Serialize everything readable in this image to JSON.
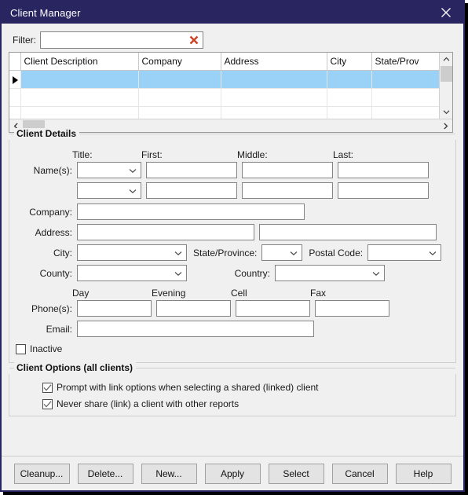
{
  "window": {
    "title": "Client Manager",
    "close_icon": "close-icon",
    "accent_color": "#282560",
    "selection_color": "#99d1f7",
    "clear_icon_color": "#cc4125"
  },
  "filter": {
    "label": "Filter:",
    "value": "",
    "placeholder": "",
    "clear_icon": "clear-x-icon"
  },
  "grid": {
    "columns": [
      "Client Description",
      "Company",
      "Address",
      "City",
      "State/Prov"
    ],
    "rows": [
      {
        "selected": true,
        "cells": [
          "",
          "",
          "",
          "",
          ""
        ]
      },
      {
        "selected": false,
        "cells": [
          "",
          "",
          "",
          "",
          ""
        ]
      },
      {
        "selected": false,
        "cells": [
          "",
          "",
          "",
          "",
          ""
        ]
      },
      {
        "selected": false,
        "cells": [
          "",
          "",
          "",
          "",
          ""
        ]
      }
    ],
    "scroll_up_icon": "chevron-up-icon",
    "scroll_down_icon": "chevron-down-icon",
    "scroll_left_icon": "chevron-left-icon",
    "scroll_right_icon": "chevron-right-icon"
  },
  "client_details": {
    "title": "Client Details",
    "name_headers": {
      "title": "Title:",
      "first": "First:",
      "middle": "Middle:",
      "last": "Last:"
    },
    "names_label": "Name(s):",
    "name_rows": [
      {
        "title": "",
        "first": "",
        "middle": "",
        "last": ""
      },
      {
        "title": "",
        "first": "",
        "middle": "",
        "last": ""
      }
    ],
    "company_label": "Company:",
    "company_value": "",
    "address_label": "Address:",
    "address_value_1": "",
    "address_value_2": "",
    "city_label": "City:",
    "city_value": "",
    "state_label": "State/Province:",
    "state_value": "",
    "postal_label": "Postal Code:",
    "postal_value": "",
    "county_label": "County:",
    "county_value": "",
    "country_label": "Country:",
    "country_value": "",
    "phone_headers": {
      "day": "Day",
      "evening": "Evening",
      "cell": "Cell",
      "fax": "Fax"
    },
    "phones_label": "Phone(s):",
    "phone_day": "",
    "phone_evening": "",
    "phone_cell": "",
    "phone_fax": "",
    "email_label": "Email:",
    "email_value": "",
    "inactive_label": "Inactive",
    "inactive_checked": false
  },
  "client_options": {
    "title": "Client Options (all clients)",
    "items": [
      {
        "label": "Prompt with link options when selecting a shared (linked) client",
        "checked": true
      },
      {
        "label": "Never share (link) a client with other reports",
        "checked": true
      }
    ]
  },
  "buttons": [
    {
      "label": "Cleanup...",
      "name": "cleanup-button"
    },
    {
      "label": "Delete...",
      "name": "delete-button"
    },
    {
      "label": "New...",
      "name": "new-button"
    },
    {
      "label": "Apply",
      "name": "apply-button"
    },
    {
      "label": "Select",
      "name": "select-button"
    },
    {
      "label": "Cancel",
      "name": "cancel-button"
    },
    {
      "label": "Help",
      "name": "help-button"
    }
  ]
}
